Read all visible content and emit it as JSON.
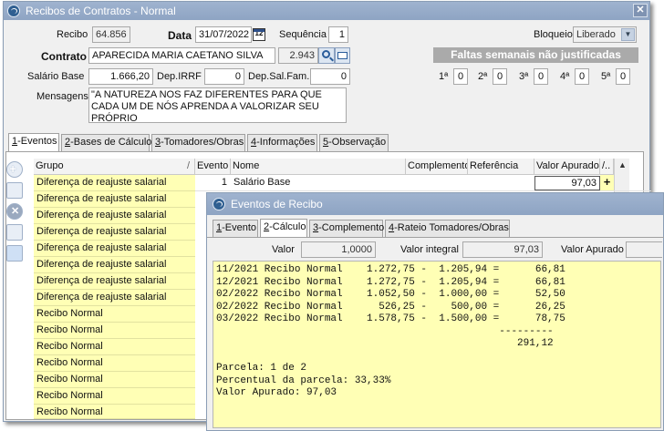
{
  "window": {
    "title": "Recibos de Contratos - Normal"
  },
  "form": {
    "recibo_label": "Recibo",
    "recibo_value": "64.856",
    "data_label": "Data",
    "data_value": "31/07/2022",
    "sequencia_label": "Sequência",
    "sequencia_value": "1",
    "bloqueio_label": "Bloqueio",
    "bloqueio_value": "Liberado",
    "contrato_label": "Contrato",
    "contrato_nome": "APARECIDA MARIA CAETANO SILVA",
    "contrato_codigo": "2.943",
    "salario_label": "Salário Base",
    "salario_value": "1.666,20",
    "depirrf_label": "Dep.IRRF",
    "depirrf_value": "0",
    "depsal_label": "Dep.Sal.Fam.",
    "depsal_value": "0",
    "mensagens_label": "Mensagens",
    "mensagens_value": "\"A NATUREZA NOS FAZ DIFERENTES PARA QUE CADA UM DE NÓS APRENDA A VALORIZAR SEU PRÓPRIO",
    "faltas_title": "Faltas semanais não justificadas",
    "faltas": [
      {
        "label": "1ª",
        "value": "0"
      },
      {
        "label": "2ª",
        "value": "0"
      },
      {
        "label": "3ª",
        "value": "0"
      },
      {
        "label": "4ª",
        "value": "0"
      },
      {
        "label": "5ª",
        "value": "0"
      }
    ]
  },
  "tabs": [
    {
      "key": "1",
      "label": "-Eventos"
    },
    {
      "key": "2",
      "label": "-Bases de Cálculo"
    },
    {
      "key": "3",
      "label": "-Tomadores/Obras"
    },
    {
      "key": "4",
      "label": "-Informações"
    },
    {
      "key": "5",
      "label": "-Observação"
    }
  ],
  "grid": {
    "headers": {
      "grupo": "Grupo",
      "evento": "Evento",
      "nome": "Nome",
      "complemento": "Complemento",
      "referencia": "Referência",
      "valor": "Valor Apurado",
      "extra": "/.."
    },
    "first_row": {
      "evento": "1",
      "nome": "Salário Base",
      "valor": "97,03",
      "plus": "+"
    },
    "grupos": [
      "Diferença de reajuste salarial",
      "Diferença de reajuste salarial",
      "Diferença de reajuste salarial",
      "Diferença de reajuste salarial",
      "Diferença de reajuste salarial",
      "Diferença de reajuste salarial",
      "Diferença de reajuste salarial",
      "Diferença de reajuste salarial",
      "Recibo Normal",
      "Recibo Normal",
      "Recibo Normal",
      "Recibo Normal",
      "Recibo Normal",
      "Recibo Normal",
      "Recibo Normal"
    ]
  },
  "overlay": {
    "title": "Eventos de Recibo",
    "tabs": [
      {
        "key": "1",
        "label": "-Evento"
      },
      {
        "key": "2",
        "label": "-Cálculo"
      },
      {
        "key": "3",
        "label": "-Complemento"
      },
      {
        "key": "4",
        "label": "-Rateio Tomadores/Obras"
      }
    ],
    "valor_label": "Valor",
    "valor_value": "1,0000",
    "valor_integral_label": "Valor integral",
    "valor_integral_value": "97,03",
    "valor_apurado_label": "Valor Apurado",
    "calc_lines": [
      "11/2021 Recibo Normal    1.272,75 -  1.205,94 =      66,81",
      "12/2021 Recibo Normal    1.272,75 -  1.205,94 =      66,81",
      "02/2022 Recibo Normal    1.052,50 -  1.000,00 =      52,50",
      "02/2022 Recibo Normal      526,25 -    500,00 =      26,25",
      "03/2022 Recibo Normal    1.578,75 -  1.500,00 =      78,75",
      "                                               ---------",
      "                                                  291,12",
      "",
      "Parcela: 1 de 2",
      "Percentual da parcela: 33,33%",
      "Valor Apurado: 97,03"
    ]
  }
}
